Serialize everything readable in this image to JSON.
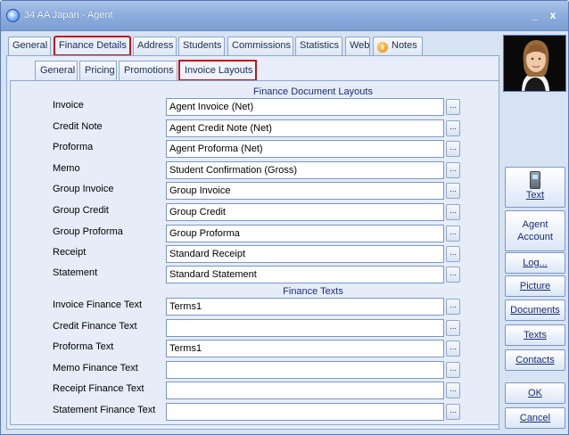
{
  "window": {
    "title": "34 AA Japan - Agent",
    "minimize": "_",
    "close": "x"
  },
  "top_tabs": [
    {
      "label": "General"
    },
    {
      "label": "Finance Details"
    },
    {
      "label": "Address"
    },
    {
      "label": "Students"
    },
    {
      "label": "Commissions"
    },
    {
      "label": "Statistics"
    },
    {
      "label": "Web"
    },
    {
      "label": "Notes"
    }
  ],
  "sub_tabs": [
    {
      "label": "General"
    },
    {
      "label": "Pricing"
    },
    {
      "label": "Promotions"
    },
    {
      "label": "Invoice Layouts"
    }
  ],
  "sections": {
    "layouts_title": "Finance Document Layouts",
    "texts_title": "Finance Texts"
  },
  "layout_rows": [
    {
      "label": "Invoice",
      "value": "Agent Invoice (Net)"
    },
    {
      "label": "Credit Note",
      "value": "Agent Credit Note (Net)"
    },
    {
      "label": "Proforma",
      "value": "Agent Proforma (Net)"
    },
    {
      "label": "Memo",
      "value": "Student Confirmation (Gross)"
    },
    {
      "label": "Group Invoice",
      "value": "Group Invoice"
    },
    {
      "label": "Group Credit",
      "value": "Group Credit"
    },
    {
      "label": "Group Proforma",
      "value": "Group Proforma"
    },
    {
      "label": "Receipt",
      "value": "Standard Receipt"
    },
    {
      "label": "Statement",
      "value": "Standard Statement"
    }
  ],
  "text_rows": [
    {
      "label": "Invoice Finance Text",
      "value": "Terms1"
    },
    {
      "label": "Credit Finance Text",
      "value": ""
    },
    {
      "label": "Proforma Text",
      "value": "Terms1"
    },
    {
      "label": "Memo Finance Text",
      "value": ""
    },
    {
      "label": "Receipt Finance Text",
      "value": ""
    },
    {
      "label": "Statement Finance Text",
      "value": ""
    }
  ],
  "dots_label": "...",
  "side_buttons": {
    "text": "Text",
    "agent_account_1": "Agent",
    "agent_account_2": "Account",
    "log": "Log...",
    "picture": "Picture",
    "documents": "Documents",
    "texts": "Texts",
    "contacts": "Contacts",
    "ok": "OK",
    "cancel": "Cancel"
  },
  "colors": {
    "highlight_outline": "#c0151d",
    "window_bg": "#d7e3f3",
    "title_bar": "#8eaedd"
  }
}
